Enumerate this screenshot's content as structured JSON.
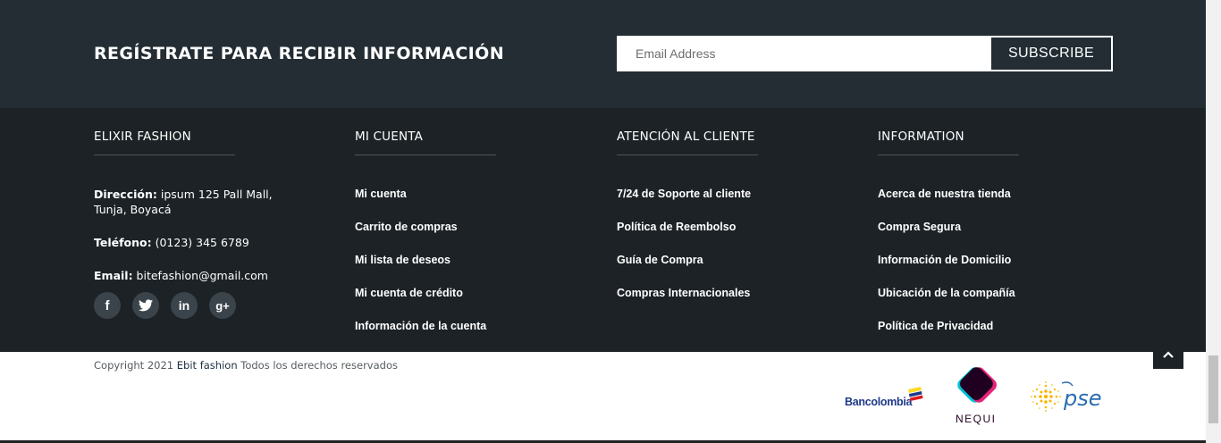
{
  "newsletter": {
    "title": "REGÍSTRATE PARA RECIBIR INFORMACIÓN",
    "email_placeholder": "Email Address",
    "subscribe_label": "SUBSCRIBE"
  },
  "columns": {
    "company": {
      "heading": "ELIXIR FASHION",
      "address_label": "Dirección:",
      "address_value": " ipsum 125 Pall Mall, Tunja, Boyacá",
      "phone_label": "Teléfono:",
      "phone_value": " (0123) 345 6789",
      "email_label": "Email:",
      "email_value": " bitefashion@gmail.com"
    },
    "account": {
      "heading": "MI CUENTA",
      "links": [
        "Mi cuenta",
        "Carrito de compras",
        "Mi lista de deseos",
        "Mi cuenta de crédito",
        "Información de la cuenta"
      ]
    },
    "support": {
      "heading": "ATENCIÓN AL CLIENTE",
      "links": [
        "7/24 de Soporte al cliente",
        "Política de Reembolso",
        "Guía de Compra",
        "Compras Internacionales"
      ]
    },
    "information": {
      "heading": "INFORMATION",
      "links": [
        "Acerca de nuestra tienda",
        "Compra Segura",
        "Información de Domicilio",
        "Ubicación de la compañía",
        "Política de Privacidad"
      ]
    }
  },
  "social": [
    {
      "icon": "facebook-icon",
      "glyph": "f"
    },
    {
      "icon": "twitter-icon",
      "glyph": "t"
    },
    {
      "icon": "linkedin-icon",
      "glyph": "in"
    },
    {
      "icon": "google-plus-icon",
      "glyph": "g+"
    }
  ],
  "copyright": {
    "prefix": "Copyright 2021 ",
    "brand": "Ebit fashion",
    "suffix": " Todos los derechos reservados"
  },
  "payment_logos": {
    "bancolombia": "Bancolombia",
    "nequi": "NEQUI",
    "pse": "pse"
  },
  "colors": {
    "newsletter_bg": "#232d33",
    "footer_bg": "#1c2226",
    "text_light": "#ffffff",
    "nequi_pink": "#e6176f",
    "nequi_purple": "#200020",
    "nequi_cyan": "#00c1d5",
    "pse_yellow": "#f7b500",
    "pse_blue": "#2a6cb0",
    "bancolombia_yellow": "#fdda24"
  }
}
